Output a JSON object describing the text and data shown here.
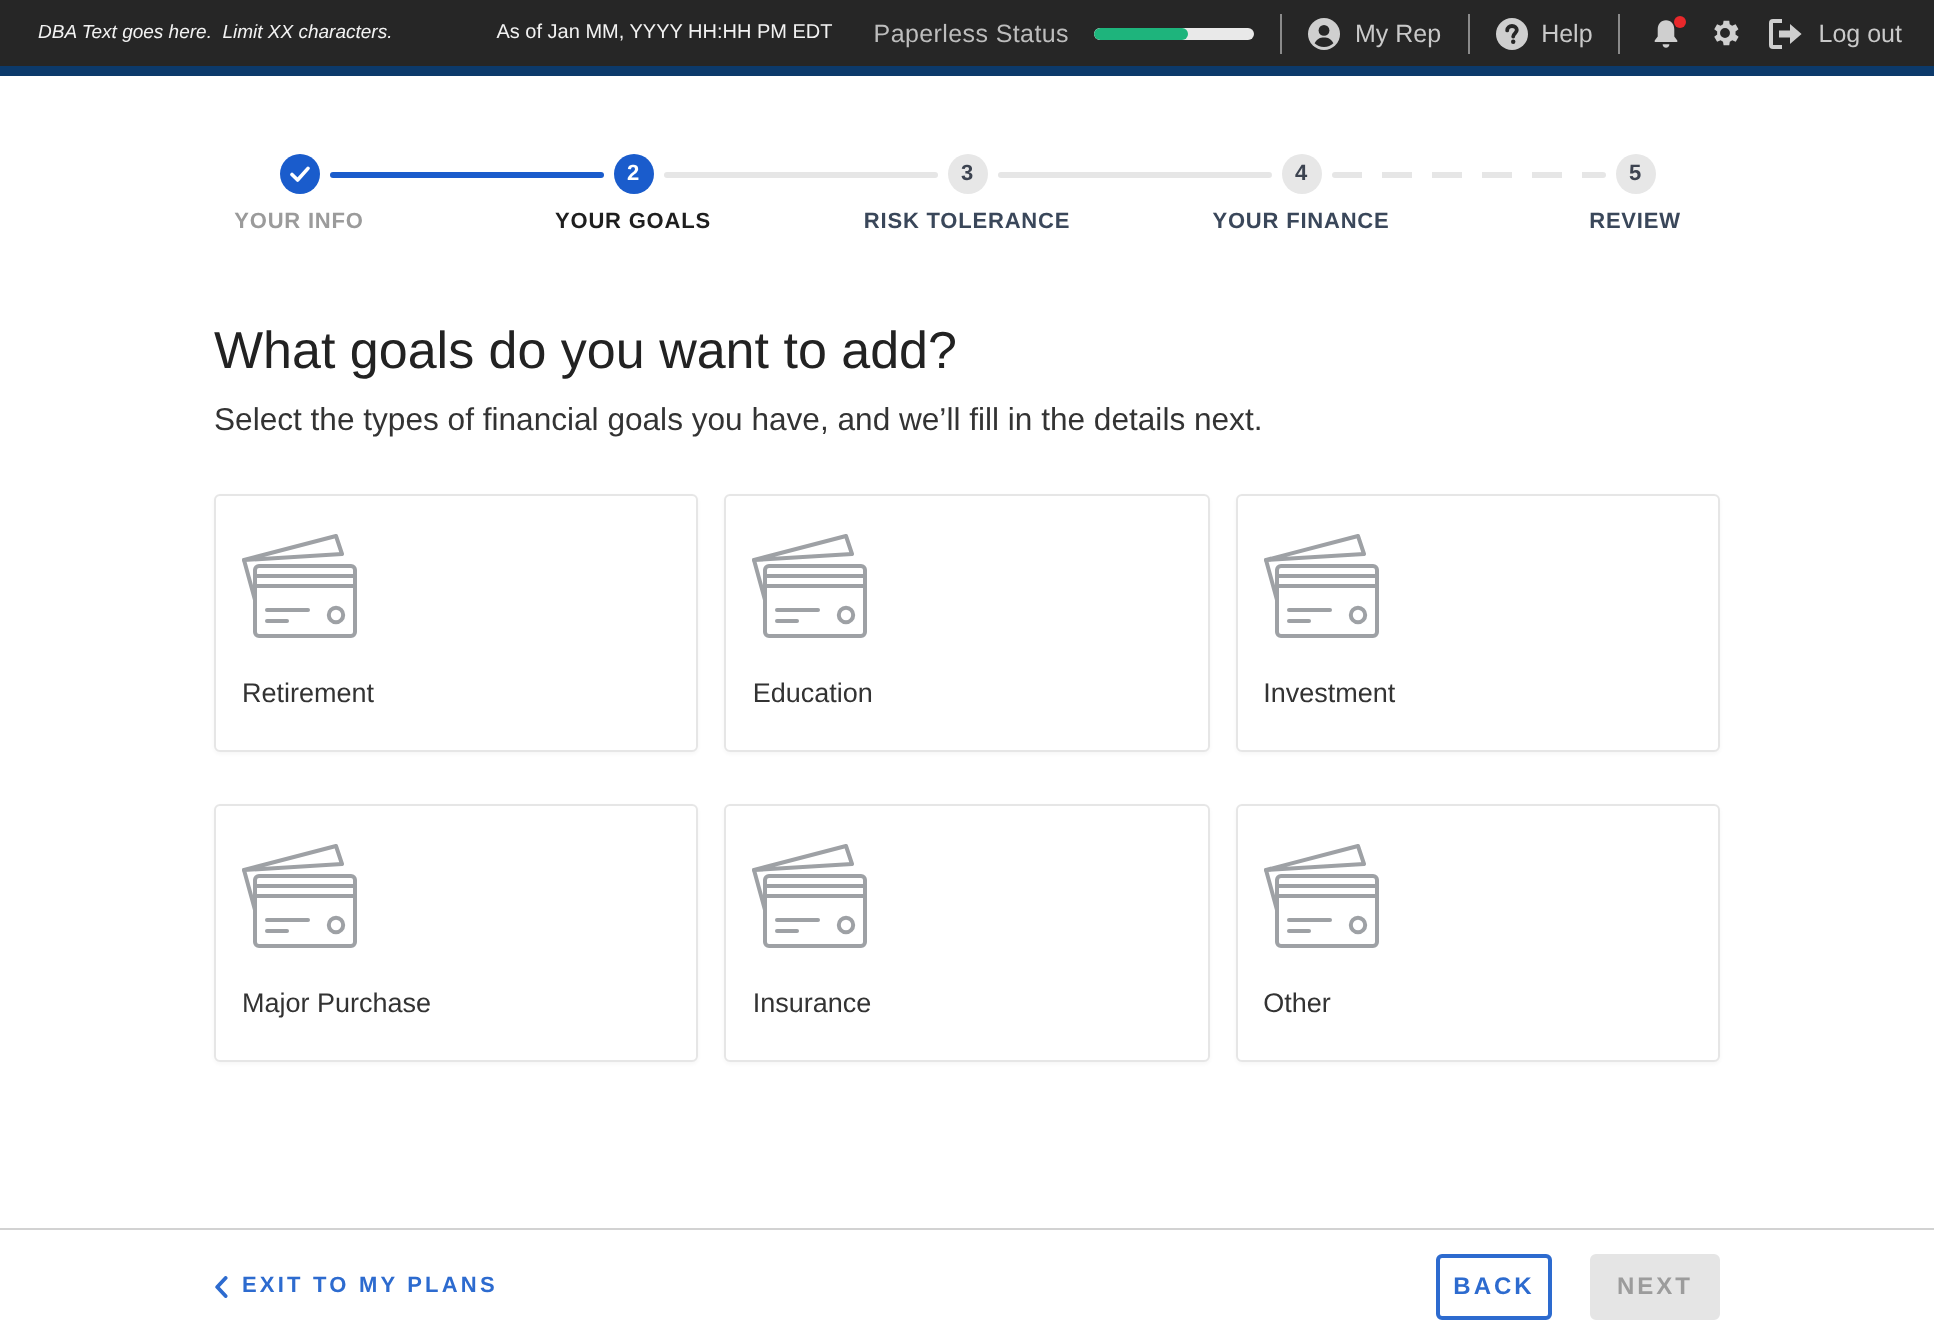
{
  "header": {
    "dba_text": "DBA Text goes here.  Limit XX characters.",
    "as_of": "As of Jan MM, YYYY HH:HH PM EDT",
    "paperless": {
      "label": "Paperless Status",
      "level": 0.58
    },
    "links": [
      {
        "kind": "rep",
        "label": "My Rep"
      },
      {
        "kind": "help",
        "label": "Help"
      }
    ],
    "notifications": {
      "unread": true
    },
    "logout": {
      "label": "Log out"
    }
  },
  "stepper": {
    "steps": [
      {
        "label": "YOUR INFO",
        "completed": true,
        "selected": false
      },
      {
        "number": "2",
        "label": "YOUR GOALS",
        "completed": false,
        "selected": true
      },
      {
        "number": "3",
        "label": "RISK TOLERANCE",
        "completed": false,
        "selected": false
      },
      {
        "number": "4",
        "label": "YOUR FINANCE",
        "completed": false,
        "selected": false
      },
      {
        "number": "5",
        "label": "REVIEW",
        "completed": false,
        "selected": false
      }
    ],
    "connectors": [
      {
        "kind": "solid",
        "done": true
      },
      {
        "kind": "solid",
        "done": false
      },
      {
        "kind": "solid",
        "done": false
      },
      {
        "kind": "dashed",
        "done": false
      }
    ]
  },
  "heading": "What goals do you want to add?",
  "subheading": "Select the types of financial goals you have, and we’ll fill in the details next.",
  "goals": [
    {
      "label": "Retirement",
      "selected": false
    },
    {
      "label": "Education",
      "selected": false
    },
    {
      "label": "Investment",
      "selected": false
    },
    {
      "label": "Major Purchase",
      "selected": false
    },
    {
      "label": "Insurance",
      "selected": false
    },
    {
      "label": "Other",
      "selected": false
    }
  ],
  "footer": {
    "exit_link": "EXIT TO MY PLANS",
    "back": "BACK",
    "next": {
      "label": "NEXT",
      "disabled": true
    }
  }
}
